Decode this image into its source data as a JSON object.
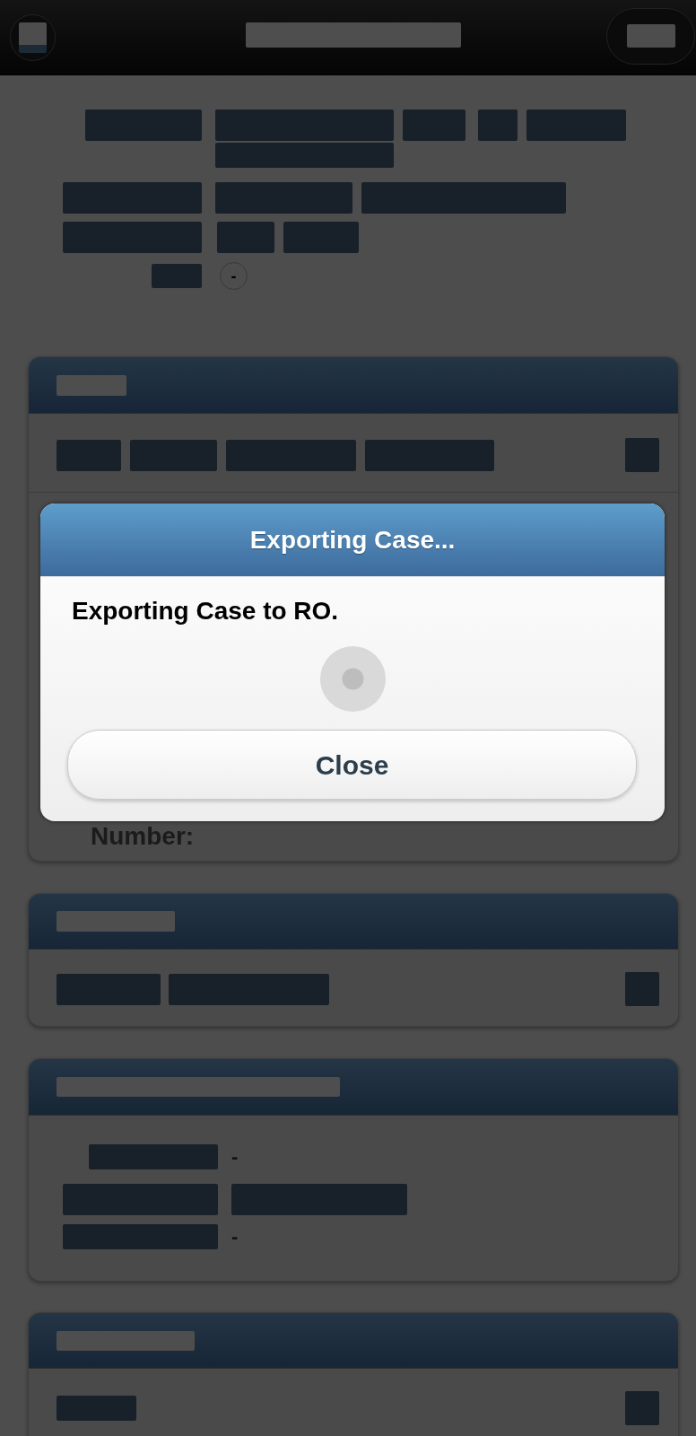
{
  "summary": {
    "toggle": "-"
  },
  "panels": [
    {
      "kind": "list",
      "field_label": "Number:"
    },
    {
      "kind": "list"
    },
    {
      "kind": "details",
      "rows": [
        {
          "kind": "dash",
          "value": "-"
        },
        {
          "kind": "redacted"
        },
        {
          "kind": "dash",
          "value": "-"
        }
      ]
    },
    {
      "kind": "list"
    }
  ],
  "dialog": {
    "title": "Exporting Case...",
    "message": "Exporting Case to RO.",
    "button": "Close"
  }
}
